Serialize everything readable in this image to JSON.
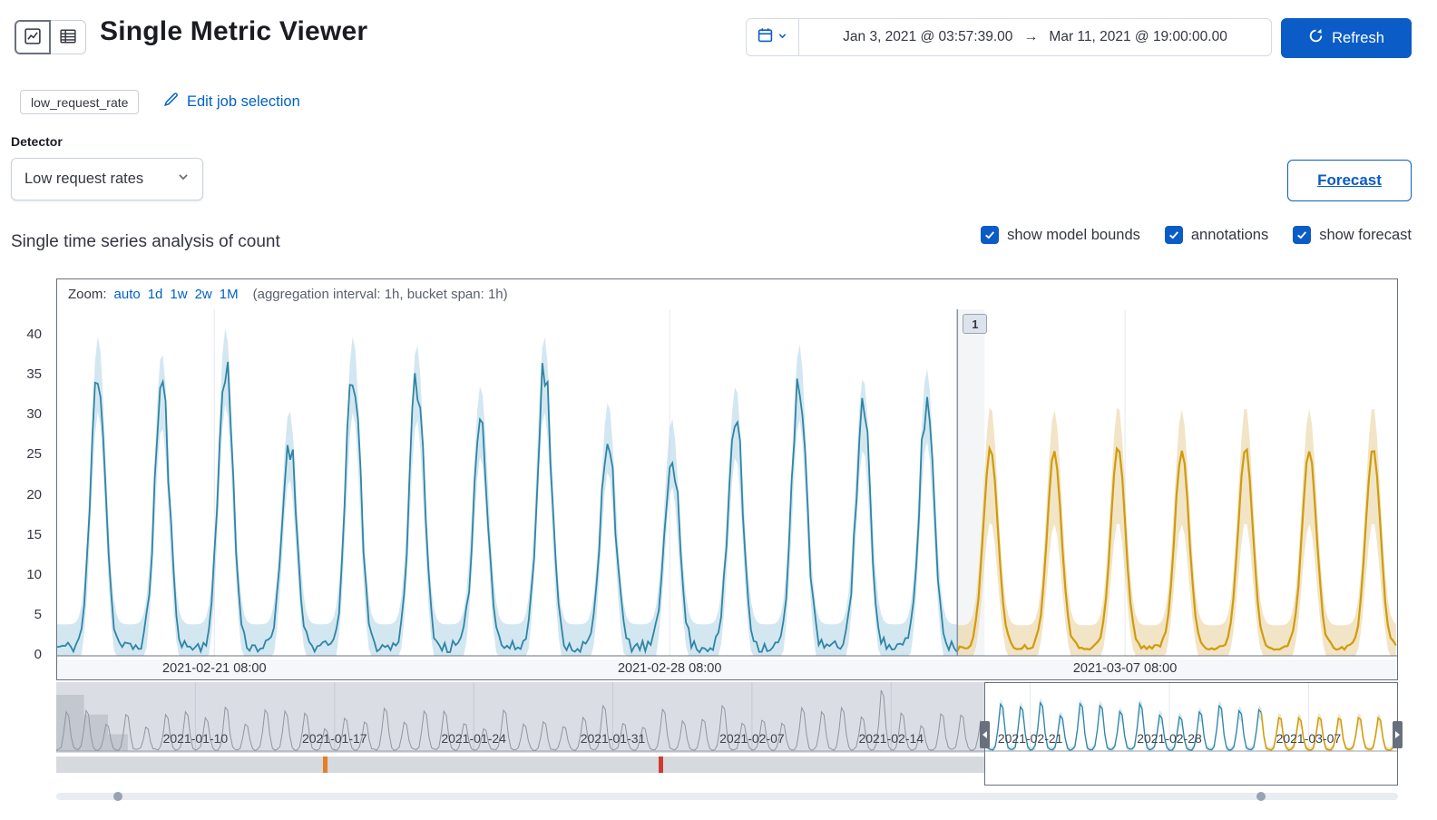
{
  "header": {
    "title": "Single Metric Viewer",
    "time_range": {
      "start": "Jan 3, 2021 @ 03:57:39.00",
      "end": "Mar 11, 2021 @ 19:00:00.00"
    },
    "arrow": "→",
    "refresh_label": "Refresh"
  },
  "job": {
    "badge": "low_request_rate",
    "edit_link": "Edit job selection"
  },
  "detector": {
    "label": "Detector",
    "selected": "Low request rates"
  },
  "forecast_button_label": "Forecast",
  "analysis": {
    "title": "Single time series analysis of count",
    "checkboxes": [
      {
        "label": "show model bounds",
        "checked": true
      },
      {
        "label": "annotations",
        "checked": true
      },
      {
        "label": "show forecast",
        "checked": true
      }
    ]
  },
  "zoom_bar": {
    "label": "Zoom:",
    "options": [
      "auto",
      "1d",
      "1w",
      "2w",
      "1M"
    ],
    "note": "(aggregation interval: 1h, bucket span: 1h)"
  },
  "colors": {
    "primary": "#0b5cc7",
    "link": "#0061c5",
    "observed_line": "#2f85a5",
    "model_bounds": "#aed4e5",
    "forecast_line": "#cf9c0a",
    "forecast_bounds": "#e9d2a0",
    "anomaly_warning": "#e57f25",
    "anomaly_critical": "#cf3b33",
    "annotation_line": "#8b93a2"
  },
  "chart_data": {
    "type": "line",
    "title": "Single time series analysis of count",
    "main": {
      "span_days": 20.6,
      "ylim": [
        0,
        43
      ],
      "y_ticks": [
        0,
        5,
        10,
        15,
        20,
        25,
        30,
        35,
        40
      ],
      "x_ticks": [
        {
          "day": 2.417,
          "label": "2021-02-21 08:00"
        },
        {
          "day": 9.417,
          "label": "2021-02-28 08:00"
        },
        {
          "day": 16.417,
          "label": "2021-03-07 08:00"
        }
      ],
      "forecast_start_day": 13.84,
      "peak_offset_day": 0.63,
      "peak_spacing_day": 0.98,
      "baseline": 1.1,
      "observed_peaks": [
        35,
        33,
        36,
        26,
        35,
        34,
        29,
        35,
        27,
        25,
        29,
        34,
        30,
        31
      ],
      "forecast_peaks": [
        25,
        24.5,
        25,
        24.5,
        25,
        24.5,
        25
      ],
      "annotation_label": "1"
    },
    "context": {
      "span_days": 67.5,
      "selection_start_day": 46.7,
      "forecast_start_day": 60.75,
      "x_ticks": [
        {
          "day": 7,
          "label": "2021-01-10"
        },
        {
          "day": 14,
          "label": "2021-01-17"
        },
        {
          "day": 21,
          "label": "2021-01-24"
        },
        {
          "day": 28,
          "label": "2021-01-31"
        },
        {
          "day": 35,
          "label": "2021-02-07"
        },
        {
          "day": 42,
          "label": "2021-02-14"
        },
        {
          "day": 49,
          "label": "2021-02-21"
        },
        {
          "day": 56,
          "label": "2021-02-28"
        },
        {
          "day": 63,
          "label": "2021-03-07"
        }
      ],
      "spike_day": 41,
      "spike_amp": 45,
      "early_bounds": [
        {
          "from": 0,
          "to": 1.4,
          "v": 40
        },
        {
          "from": 1.4,
          "to": 2.6,
          "v": 26
        },
        {
          "from": 2.6,
          "to": 3.6,
          "v": 12
        }
      ],
      "anomalies": [
        {
          "day": 13.5,
          "color": "#e57f25"
        },
        {
          "day": 30.4,
          "color": "#cf3b33"
        }
      ]
    }
  }
}
